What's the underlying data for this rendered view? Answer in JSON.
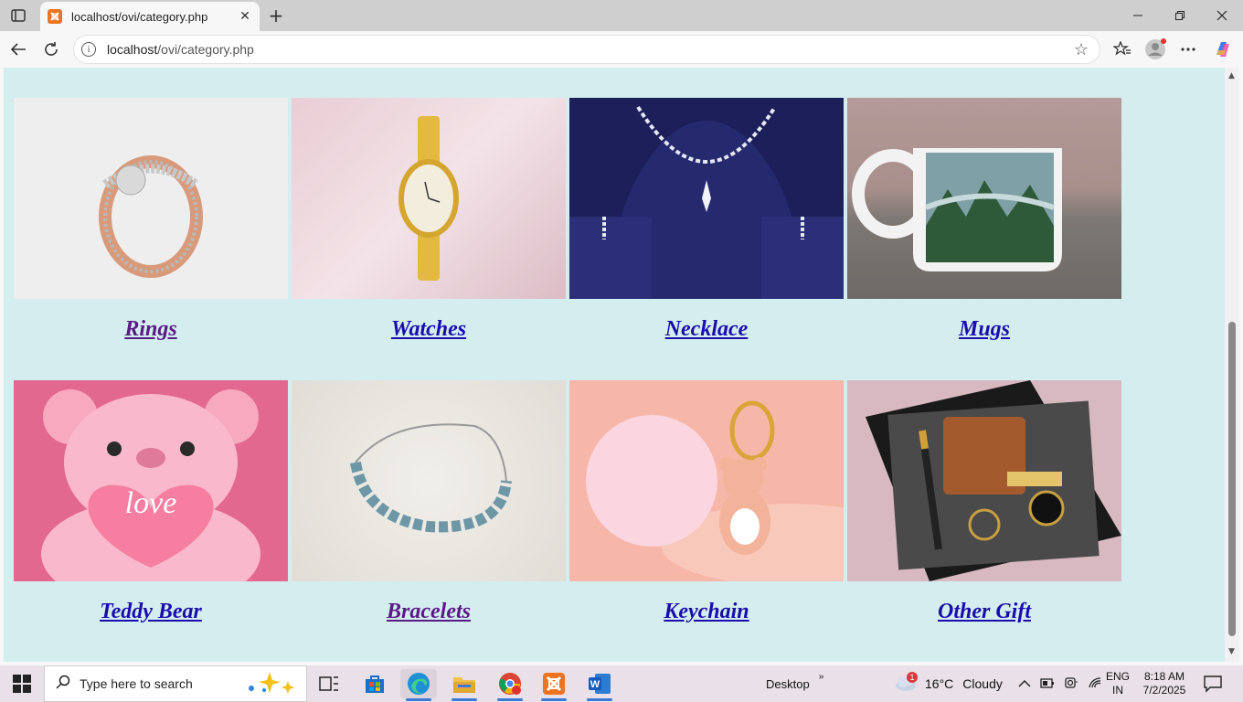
{
  "browser": {
    "tab_title": "localhost/ovi/category.php",
    "url_host": "localhost",
    "url_path": "/ovi/category.php",
    "favicon": "xampp-icon",
    "icons": {
      "tab_actions": "tab-actions-icon",
      "new_tab": "plus-icon",
      "minimize": "minimize-icon",
      "restore": "restore-icon",
      "close": "close-icon",
      "back": "back-arrow-icon",
      "refresh": "refresh-icon",
      "info": "info-icon",
      "favorite": "star-icon",
      "collections": "favorites-icon",
      "profile": "profile-avatar",
      "menu": "more-icon",
      "copilot": "copilot-icon"
    }
  },
  "categories": [
    {
      "label": "Rings",
      "visited": true,
      "image": "rose-gold diamond ring"
    },
    {
      "label": "Watches",
      "visited": false,
      "image": "gold ladies watch"
    },
    {
      "label": "Necklace",
      "visited": false,
      "image": "diamond necklace set on navy bust"
    },
    {
      "label": "Mugs",
      "visited": false,
      "image": "mug with forest landscape print"
    },
    {
      "label": "Teddy Bear",
      "visited": false,
      "image": "pink teddy bear holding love heart"
    },
    {
      "label": "Bracelets",
      "visited": true,
      "image": "blue crystal bracelet"
    },
    {
      "label": "Keychain",
      "visited": false,
      "image": "pink pom pom bear keychain"
    },
    {
      "label": "Other Gift",
      "visited": false,
      "image": "wallet, pen and keychain gift box"
    }
  ],
  "colors": {
    "page_bg": "#d4eef0",
    "link": "#1a0dab",
    "visited_link": "#5a1a84"
  },
  "taskbar": {
    "search_placeholder": "Type here to search",
    "desktop_label": "Desktop",
    "weather_temp": "16°C",
    "weather_text": "Cloudy",
    "weather_badge": "1",
    "lang_top": "ENG",
    "lang_bottom": "IN",
    "time": "8:18 AM",
    "date": "7/2/2025"
  }
}
